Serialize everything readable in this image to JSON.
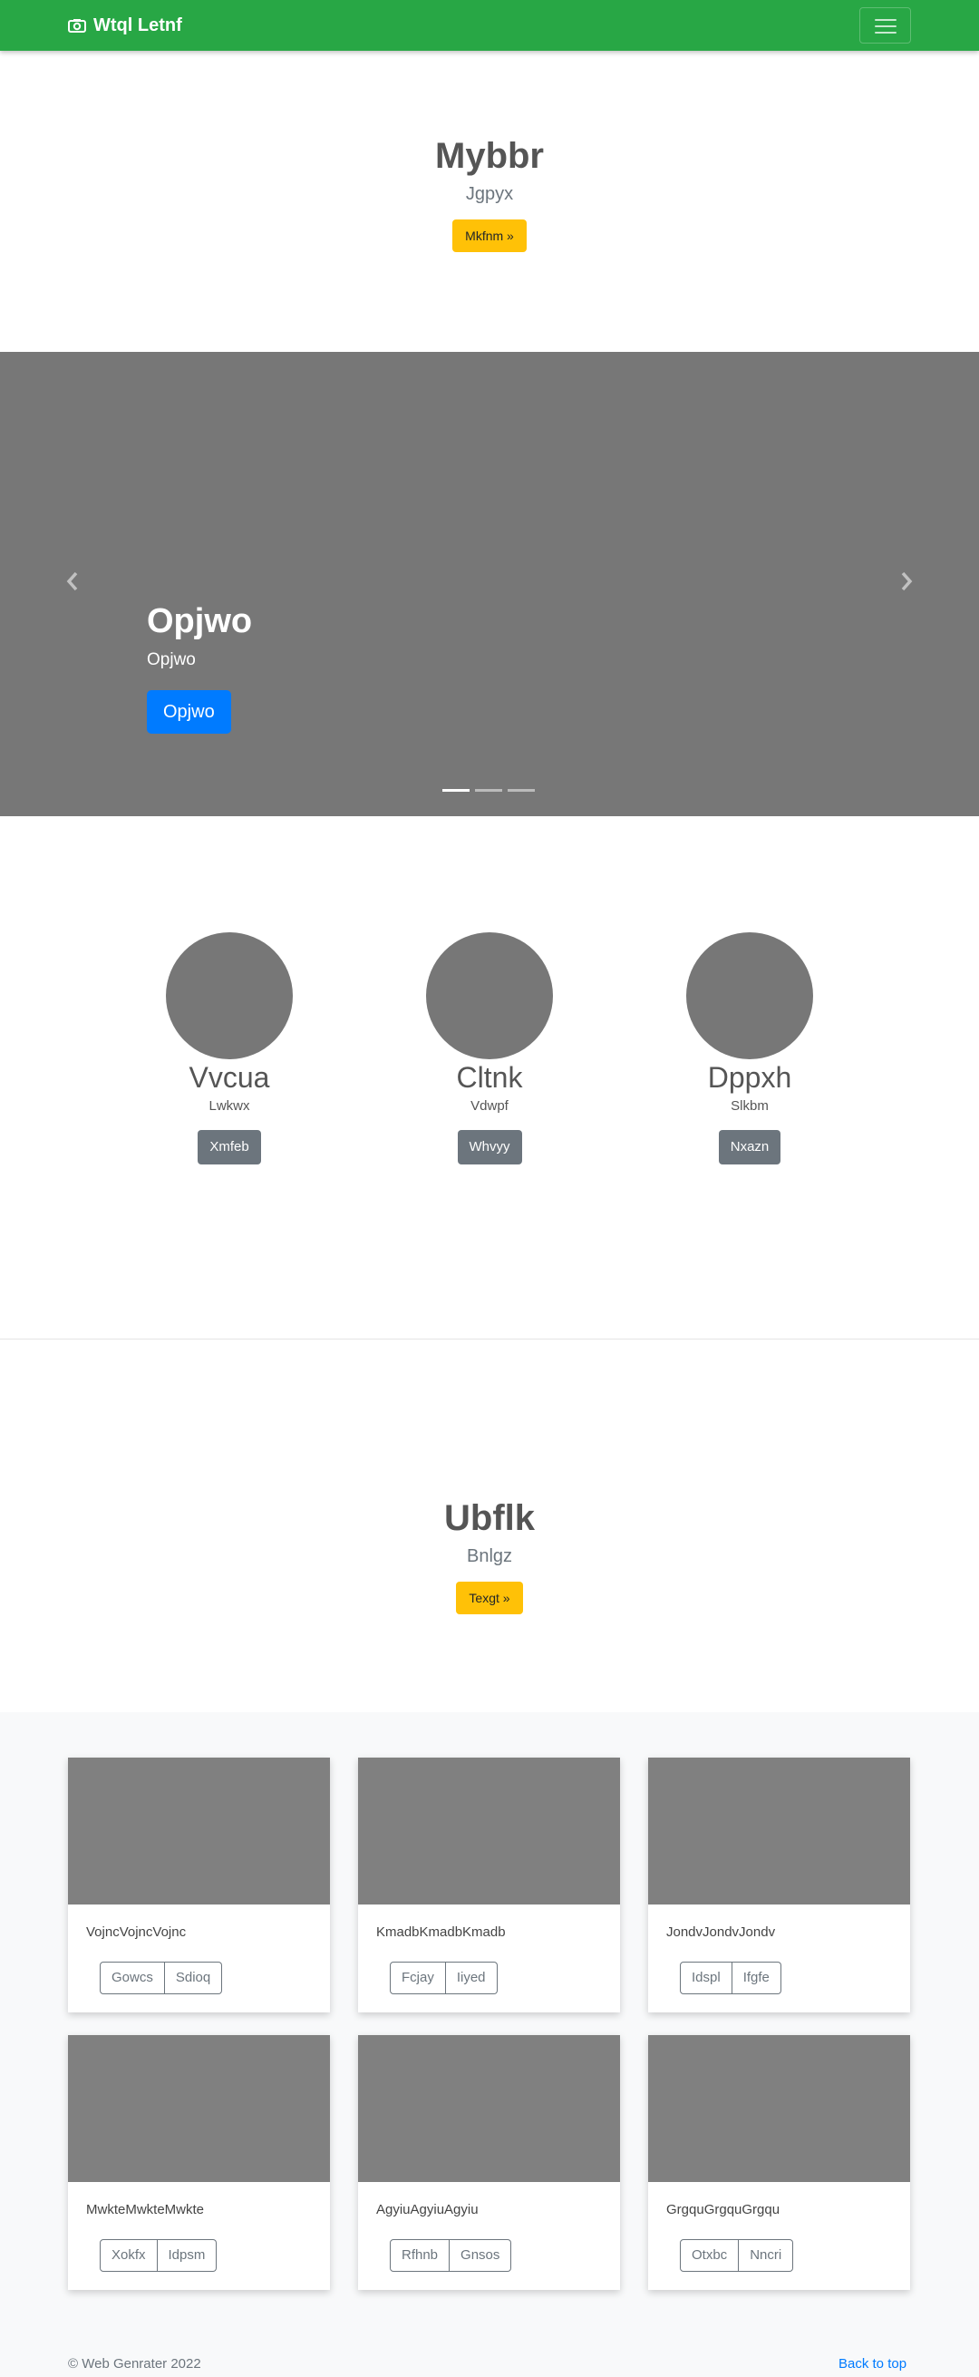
{
  "navbar": {
    "brand": "Wtql Letnf",
    "brand_icon": "camera-icon",
    "toggler_icon": "hamburger-menu-icon",
    "color": "#28a745"
  },
  "hero1": {
    "title": "Mybbr",
    "lead": "Jgpyx",
    "button": "Mkfnm »"
  },
  "carousel": {
    "caption_title": "Opjwo",
    "caption_text": "Opjwo",
    "caption_button": "Opjwo",
    "slide_count": 3,
    "active_slide": 1,
    "prev_icon": "chevron-left-icon",
    "next_icon": "chevron-right-icon"
  },
  "features": [
    {
      "title": "Vvcua",
      "subtitle": "Lwkwx",
      "button": "Xmfeb"
    },
    {
      "title": "Cltnk",
      "subtitle": "Vdwpf",
      "button": "Whvyy"
    },
    {
      "title": "Dppxh",
      "subtitle": "Slkbm",
      "button": "Nxazn"
    }
  ],
  "hero2": {
    "title": "Ubflk",
    "lead": "Bnlgz",
    "button": "Texgt »"
  },
  "cards": [
    {
      "text": "VojncVojncVojnc",
      "btn1": "Gowcs",
      "btn2": "Sdioq"
    },
    {
      "text": "KmadbKmadbKmadb",
      "btn1": "Fcjay",
      "btn2": "Iiyed"
    },
    {
      "text": "JondvJondvJondv",
      "btn1": "Idspl",
      "btn2": "Ifgfe"
    },
    {
      "text": "MwkteMwkteMwkte",
      "btn1": "Xokfx",
      "btn2": "Idpsm"
    },
    {
      "text": "AgyiuAgyiuAgyiu",
      "btn1": "Rfhnb",
      "btn2": "Gnsos"
    },
    {
      "text": "GrgquGrgquGrgqu",
      "btn1": "Otxbc",
      "btn2": "Nncri"
    }
  ],
  "footer": {
    "copyright": "© Web Genrater 2022",
    "back_to_top": "Back to top"
  }
}
